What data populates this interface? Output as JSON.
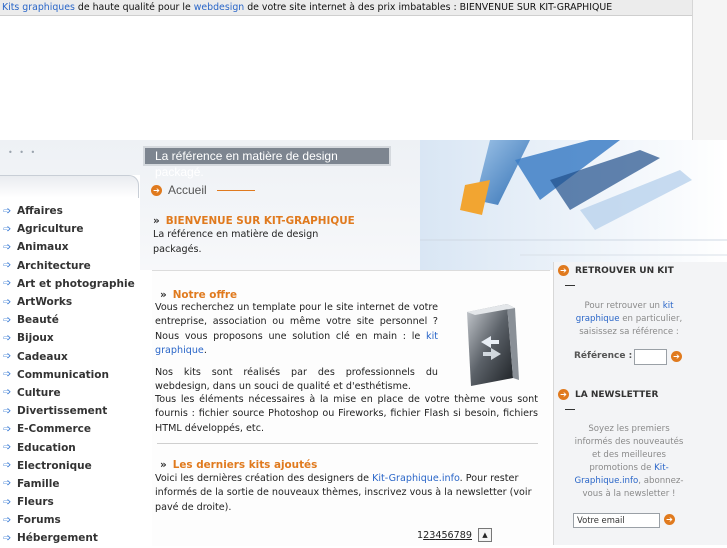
{
  "topbar": {
    "link1": "Kits graphiques",
    "text1": " de haute qualité pour le ",
    "link2": "webdesign",
    "text2": " de votre site internet à des prix imbatables : BIENVENUE SUR KIT-GRAPHIQUE"
  },
  "banner": {
    "tagline": "La référence en matière de design packagé.",
    "dots": "• • •"
  },
  "nav": {
    "accueil": "Accueil",
    "arrow": "➔"
  },
  "welcome": {
    "title": "BIENVENUE SUR KIT-GRAPHIQUE",
    "text": "La référence en matière de design packagés."
  },
  "offre": {
    "title": "Notre offre",
    "p1_a": "Vous recherchez un template pour le site internet de votre entreprise, association ou même votre site personnel ? Nous vous proposons une solution clé en main : le ",
    "p1_link": "kit graphique",
    "p1_b": ".",
    "p2": "Nos kits sont réalisés par des professionnels du webdesign, dans un souci de qualité et d'esthétisme.",
    "p3": "Tous les éléments nécessaires à la mise en place de votre thème vous sont fournis : fichier source Photoshop ou Fireworks, fichier Flash si besoin, fichiers HTML développés, etc."
  },
  "derniers": {
    "title": "Les derniers kits ajoutés",
    "text_a": "Voici les dernières création des designers de ",
    "text_link": "Kit-Graphique.info",
    "text_b": ". Pour rester informés de la sortie de nouveaux thèmes, inscrivez vous à la newsletter (voir pavé de droite)."
  },
  "pager": {
    "current": "1",
    "pages": [
      "2",
      "3",
      "4",
      "5",
      "6",
      "7",
      "8",
      "9"
    ],
    "up": "▲"
  },
  "categories": [
    "Affaires",
    "Agriculture",
    "Animaux",
    "Architecture",
    "Art et photographie",
    "ArtWorks",
    "Beauté",
    "Bijoux",
    "Cadeaux",
    "Communication",
    "Culture",
    "Divertissement",
    "E-Commerce",
    "Education",
    "Electronique",
    "Famille",
    "Fleurs",
    "Forums",
    "Hébergement"
  ],
  "retrouver": {
    "title": "RETROUVER UN KIT",
    "text_a": "Pour retrouver un ",
    "text_link": "kit graphique",
    "text_b": " en particulier, saisissez sa référence :",
    "ref_label": "Référence :",
    "ref_value": ""
  },
  "newsletter": {
    "title": "LA NEWSLETTER",
    "text_a": "Soyez les premiers informés des nouveautés et des meilleures promotions de ",
    "text_link": "Kit-Graphique.info",
    "text_b": ", abonnez-vous à la newsletter !",
    "email_value": "Votre email"
  },
  "colors": {
    "accent": "#e07a1e",
    "link": "#2a66c8",
    "tagline_bg": "#7d8590"
  }
}
